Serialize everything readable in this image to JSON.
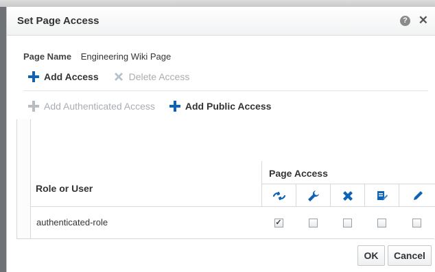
{
  "dialog": {
    "title": "Set Page Access"
  },
  "page_name": {
    "label": "Page Name",
    "value": "Engineering Wiki Page"
  },
  "toolbar": {
    "add_access": "Add Access",
    "delete_access": "Delete Access",
    "add_authenticated_access": "Add Authenticated Access",
    "add_public_access": "Add Public Access"
  },
  "table": {
    "role_header": "Role or User",
    "page_access_header": "Page Access",
    "access_columns": [
      "view-icon",
      "customize-icon",
      "delete-icon",
      "edit-icon",
      "update-icon"
    ],
    "rows": [
      {
        "role": "authenticated-role",
        "permissions": [
          true,
          false,
          false,
          false,
          false
        ]
      }
    ]
  },
  "buttons": {
    "ok": "OK",
    "cancel": "Cancel"
  },
  "colors": {
    "accent_blue": "#0d63b6",
    "disabled_gray": "#a9adb1",
    "border": "#d6d9dc"
  }
}
